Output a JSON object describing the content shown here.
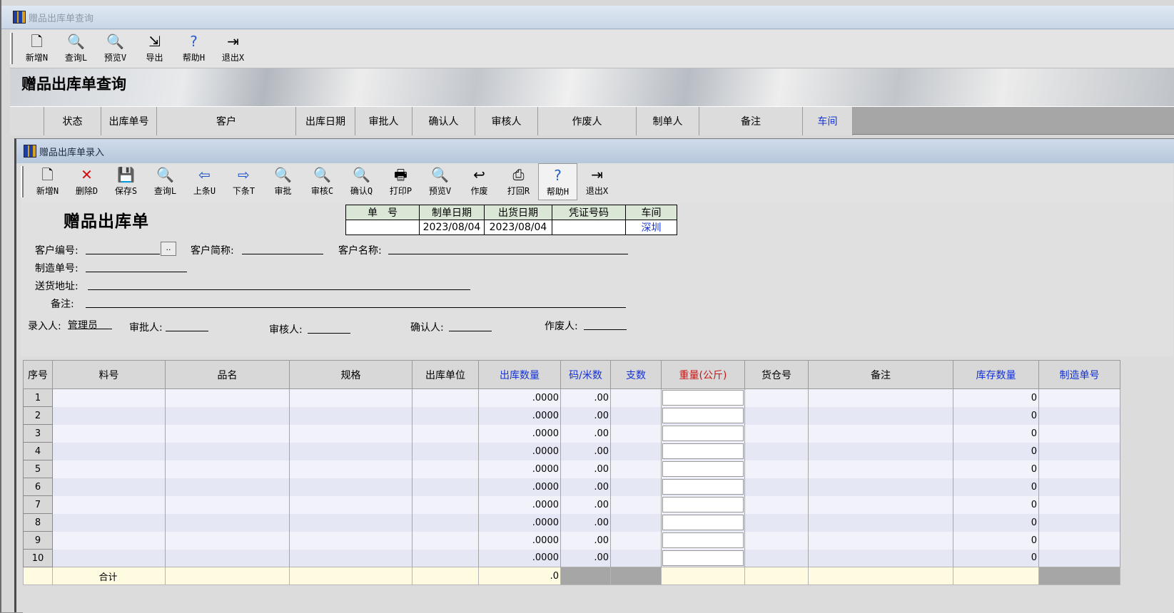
{
  "outer": {
    "title": "赠品出库单查询",
    "toolbar": [
      {
        "label": "新增N",
        "icon": "new-doc-icon",
        "glyph": "🗋"
      },
      {
        "label": "查询L",
        "icon": "query-doc-icon",
        "glyph": "🔍"
      },
      {
        "label": "预览V",
        "icon": "preview-icon",
        "glyph": "🔍"
      },
      {
        "label": "导出",
        "icon": "export-icon",
        "glyph": "⇲"
      },
      {
        "label": "帮助H",
        "icon": "help-icon",
        "glyph": "?"
      },
      {
        "label": "退出X",
        "icon": "exit-icon",
        "glyph": "⇥"
      }
    ],
    "banner_title": "赠品出库单查询",
    "columns": [
      "",
      "状态",
      "出库单号",
      "客户",
      "出库日期",
      "审批人",
      "确认人",
      "审核人",
      "作废人",
      "制单人",
      "备注",
      "车间"
    ]
  },
  "inner": {
    "title": "赠品出库单录入",
    "toolbar": [
      {
        "label": "新增N",
        "icon": "new-doc-icon",
        "glyph": "🗋"
      },
      {
        "label": "删除D",
        "icon": "delete-icon",
        "glyph": "✕"
      },
      {
        "label": "保存S",
        "icon": "save-icon",
        "glyph": "💾"
      },
      {
        "label": "查询L",
        "icon": "query-doc-icon",
        "glyph": "🔍"
      },
      {
        "label": "上条U",
        "icon": "prev-arrow-icon",
        "glyph": "⇦"
      },
      {
        "label": "下条T",
        "icon": "next-arrow-icon",
        "glyph": "⇨"
      },
      {
        "label": "审批",
        "icon": "approve-search-icon",
        "glyph": "🔍"
      },
      {
        "label": "审核C",
        "icon": "audit-search-icon",
        "glyph": "🔍"
      },
      {
        "label": "确认Q",
        "icon": "confirm-search-icon",
        "glyph": "🔍"
      },
      {
        "label": "打印P",
        "icon": "printer-icon",
        "glyph": "🖶"
      },
      {
        "label": "预览V",
        "icon": "preview-icon",
        "glyph": "🔍"
      },
      {
        "label": "作废",
        "icon": "void-icon",
        "glyph": "↩"
      },
      {
        "label": "打回R",
        "icon": "reject-icon",
        "glyph": "⎙"
      },
      {
        "label": "帮助H",
        "icon": "help-icon",
        "glyph": "?"
      },
      {
        "label": "退出X",
        "icon": "exit-icon",
        "glyph": "⇥"
      }
    ],
    "form_title": "赠品出库单",
    "info_headers": [
      "单　号",
      "制单日期",
      "出货日期",
      "凭证号码",
      "车间"
    ],
    "info_values": [
      "",
      "2023/08/04",
      "2023/08/04",
      "",
      "深圳"
    ],
    "labels": {
      "customer_no": "客户编号:",
      "customer_short": "客户简称:",
      "customer_name": "客户名称:",
      "mfg_no": "制造单号:",
      "address": "送货地址:",
      "remark": "备注:",
      "entered_by": "录入人:",
      "approved_by": "审批人:",
      "audited_by": "审核人:",
      "confirmed_by": "确认人:",
      "voided_by": "作废人:"
    },
    "values": {
      "customer_no": "",
      "customer_short": "",
      "customer_name": "",
      "mfg_no": "",
      "address": "",
      "remark": "",
      "entered_by": "管理员",
      "approved_by": "",
      "audited_by": "",
      "confirmed_by": "",
      "voided_by": ""
    },
    "browse_button": "..",
    "grid": {
      "columns": [
        "序号",
        "料号",
        "品名",
        "规格",
        "出库单位",
        "出库数量",
        "码/米数",
        "支数",
        "重量(公斤)",
        "货仓号",
        "备注",
        "库存数量",
        "制造单号"
      ],
      "rows": [
        {
          "seq": "1",
          "qty": ".0000",
          "yards": ".00",
          "stock": "0"
        },
        {
          "seq": "2",
          "qty": ".0000",
          "yards": ".00",
          "stock": "0"
        },
        {
          "seq": "3",
          "qty": ".0000",
          "yards": ".00",
          "stock": "0"
        },
        {
          "seq": "4",
          "qty": ".0000",
          "yards": ".00",
          "stock": "0"
        },
        {
          "seq": "5",
          "qty": ".0000",
          "yards": ".00",
          "stock": "0"
        },
        {
          "seq": "6",
          "qty": ".0000",
          "yards": ".00",
          "stock": "0"
        },
        {
          "seq": "7",
          "qty": ".0000",
          "yards": ".00",
          "stock": "0"
        },
        {
          "seq": "8",
          "qty": ".0000",
          "yards": ".00",
          "stock": "0"
        },
        {
          "seq": "9",
          "qty": ".0000",
          "yards": ".00",
          "stock": "0"
        },
        {
          "seq": "10",
          "qty": ".0000",
          "yards": ".00",
          "stock": "0"
        }
      ],
      "total_label": "合计",
      "total_qty": ".0"
    }
  }
}
